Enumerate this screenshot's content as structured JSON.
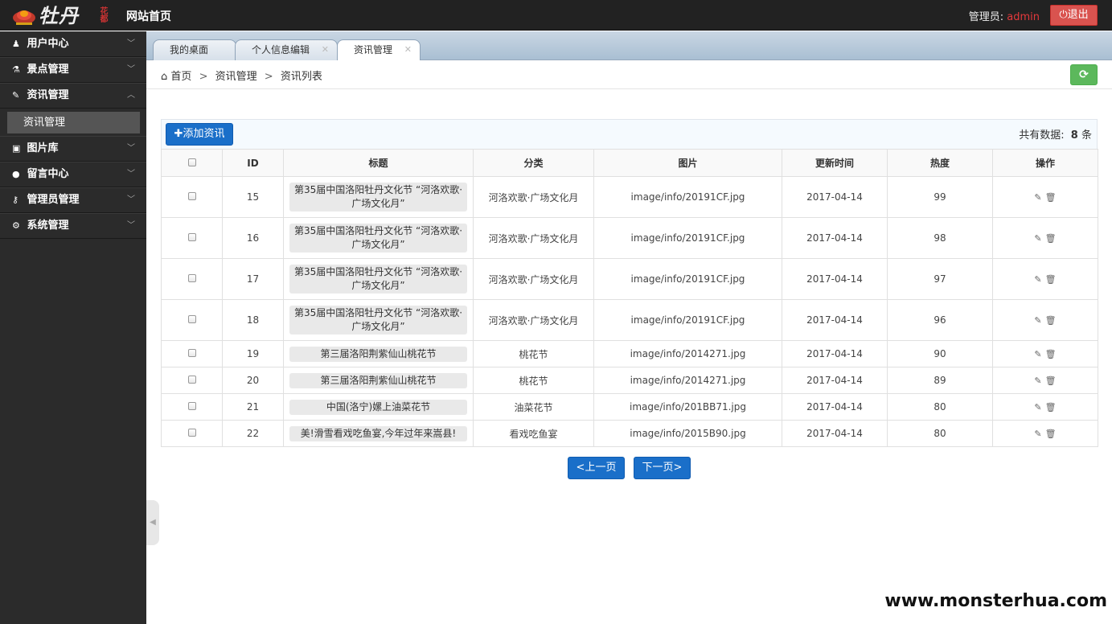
{
  "header": {
    "brand_text": "牡丹",
    "seal_text": "花都",
    "site_title": "网站首页",
    "admin_prefix": "管理员:",
    "admin_name": "admin",
    "logout_label": "退出"
  },
  "sidebar": {
    "items": [
      {
        "label": "用户中心",
        "icon": "user-icon",
        "glyph": "♟"
      },
      {
        "label": "景点管理",
        "icon": "flask-icon",
        "glyph": "⚗"
      },
      {
        "label": "资讯管理",
        "icon": "edit-icon",
        "glyph": "✎"
      },
      {
        "label": "图片库",
        "icon": "picture-icon",
        "glyph": "▣"
      },
      {
        "label": "留言中心",
        "icon": "comments-icon",
        "glyph": "●"
      },
      {
        "label": "管理员管理",
        "icon": "key-icon",
        "glyph": "⚷"
      },
      {
        "label": "系统管理",
        "icon": "cogs-icon",
        "glyph": "⚙"
      }
    ],
    "active_sub": "资讯管理"
  },
  "tabs": [
    {
      "label": "我的桌面"
    },
    {
      "label": "个人信息编辑"
    },
    {
      "label": "资讯管理"
    }
  ],
  "breadcrumb": {
    "home": "首页",
    "level1": "资讯管理",
    "level2": "资讯列表",
    "sep": ">"
  },
  "toolbar": {
    "add_label": "添加资讯",
    "count_prefix": "共有数据:",
    "count_value": "8",
    "count_unit": "条"
  },
  "table": {
    "headers": [
      "ID",
      "标题",
      "分类",
      "图片",
      "更新时间",
      "热度",
      "操作"
    ],
    "rows": [
      {
        "id": "15",
        "title": "第35届中国洛阳牡丹文化节 “河洛欢歌·广场文化月”",
        "category": "河洛欢歌·广场文化月",
        "image": "image/info/20191CF.jpg",
        "updated": "2017-04-14",
        "heat": "99"
      },
      {
        "id": "16",
        "title": "第35届中国洛阳牡丹文化节 “河洛欢歌·广场文化月”",
        "category": "河洛欢歌·广场文化月",
        "image": "image/info/20191CF.jpg",
        "updated": "2017-04-14",
        "heat": "98"
      },
      {
        "id": "17",
        "title": "第35届中国洛阳牡丹文化节 “河洛欢歌·广场文化月”",
        "category": "河洛欢歌·广场文化月",
        "image": "image/info/20191CF.jpg",
        "updated": "2017-04-14",
        "heat": "97"
      },
      {
        "id": "18",
        "title": "第35届中国洛阳牡丹文化节 “河洛欢歌·广场文化月”",
        "category": "河洛欢歌·广场文化月",
        "image": "image/info/20191CF.jpg",
        "updated": "2017-04-14",
        "heat": "96"
      },
      {
        "id": "19",
        "title": "第三届洛阳荆紫仙山桃花节",
        "category": "桃花节",
        "image": "image/info/2014271.jpg",
        "updated": "2017-04-14",
        "heat": "90"
      },
      {
        "id": "20",
        "title": "第三届洛阳荆紫仙山桃花节",
        "category": "桃花节",
        "image": "image/info/2014271.jpg",
        "updated": "2017-04-14",
        "heat": "89"
      },
      {
        "id": "21",
        "title": "中国(洛宁)嫘上油菜花节",
        "category": "油菜花节",
        "image": "image/info/201BB71.jpg",
        "updated": "2017-04-14",
        "heat": "80"
      },
      {
        "id": "22",
        "title": "美!滑雪看戏吃鱼宴,今年过年来嵩县!",
        "category": "看戏吃鱼宴",
        "image": "image/info/2015B90.jpg",
        "updated": "2017-04-14",
        "heat": "80"
      }
    ]
  },
  "pager": {
    "prev_label": "<上一页",
    "next_label": "下一页>"
  },
  "watermark": "www.monsterhua.com"
}
